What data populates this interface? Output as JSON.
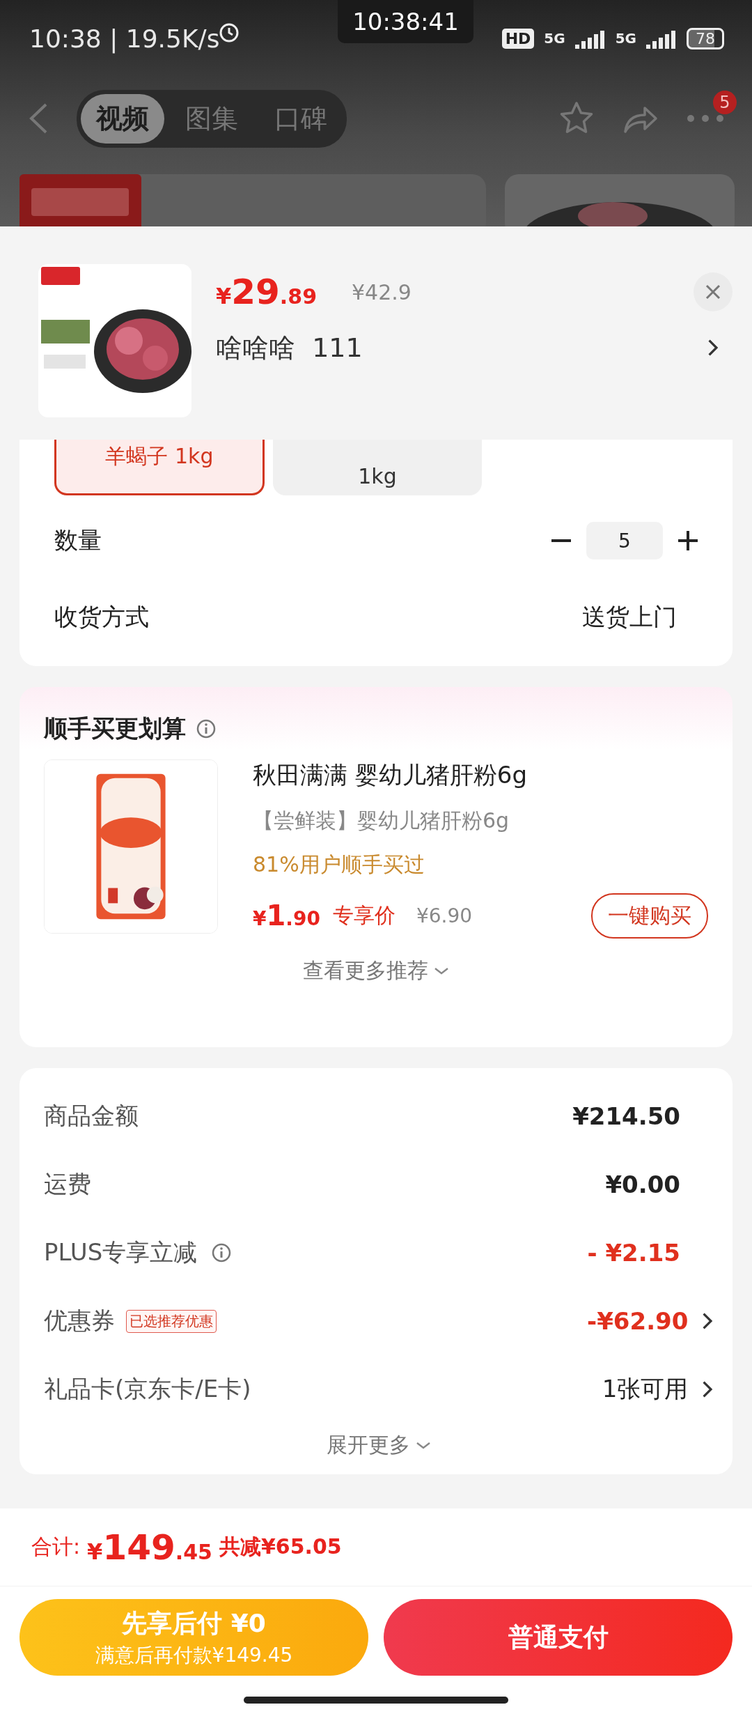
{
  "status_bar": {
    "time": "10:38 | 19.5K/s",
    "clock": "10:38:41",
    "hd": "HD",
    "signals": [
      "5G",
      "5G"
    ],
    "battery": "78"
  },
  "nav": {
    "tabs": [
      {
        "label": "视频",
        "selected": true
      },
      {
        "label": "图集",
        "selected": false
      },
      {
        "label": "口碑",
        "selected": false
      }
    ],
    "badge": "5"
  },
  "product": {
    "currency": "¥",
    "price_int": "29",
    "price_dec": ".89",
    "original_price": "¥42.9",
    "selection": "啥啥啥  111"
  },
  "spec_options": [
    {
      "label": "羊蝎子 1kg",
      "selected": true
    },
    {
      "label": "1kg",
      "selected": false
    }
  ],
  "quantity": {
    "label": "数量",
    "value": "5"
  },
  "delivery": {
    "label": "收货方式",
    "value": "送货上门"
  },
  "recommend": {
    "title": "顺手买更划算",
    "name": "秋田满满 婴幼儿猪肝粉6g",
    "subtitle": "【尝鲜装】婴幼儿猪肝粉6g",
    "social": "81%用户顺手买过",
    "currency": "¥",
    "price_int": "1",
    "price_dec": ".90",
    "price_tag": "专享价",
    "original_price": "¥6.90",
    "buy_button": "一键购买",
    "more": "查看更多推荐"
  },
  "summary": {
    "rows": [
      {
        "label": "商品金额",
        "value": "¥214.50",
        "kind": "amount",
        "info": false,
        "link": false
      },
      {
        "label": "运费",
        "value": "¥0.00",
        "kind": "amount",
        "info": false,
        "link": false
      },
      {
        "label": "PLUS专享立减",
        "value": "- ¥2.15",
        "kind": "discount",
        "info": true,
        "link": false
      },
      {
        "label": "优惠券",
        "tag": "已选推荐优惠",
        "value": "-¥62.90",
        "kind": "discount",
        "info": false,
        "link": true
      },
      {
        "label": "礼品卡(京东卡/E卡)",
        "value": "1张可用",
        "kind": "plain",
        "info": false,
        "link": true
      }
    ],
    "expand": "展开更多"
  },
  "footer": {
    "total_label": "合计:",
    "currency": "¥",
    "total_int": "149",
    "total_dec": ".45",
    "saved": "共减¥65.05",
    "pay_later": {
      "title": "先享后付 ¥0",
      "subtitle": "满意后再付款¥149.45"
    },
    "pay": "普通支付"
  }
}
